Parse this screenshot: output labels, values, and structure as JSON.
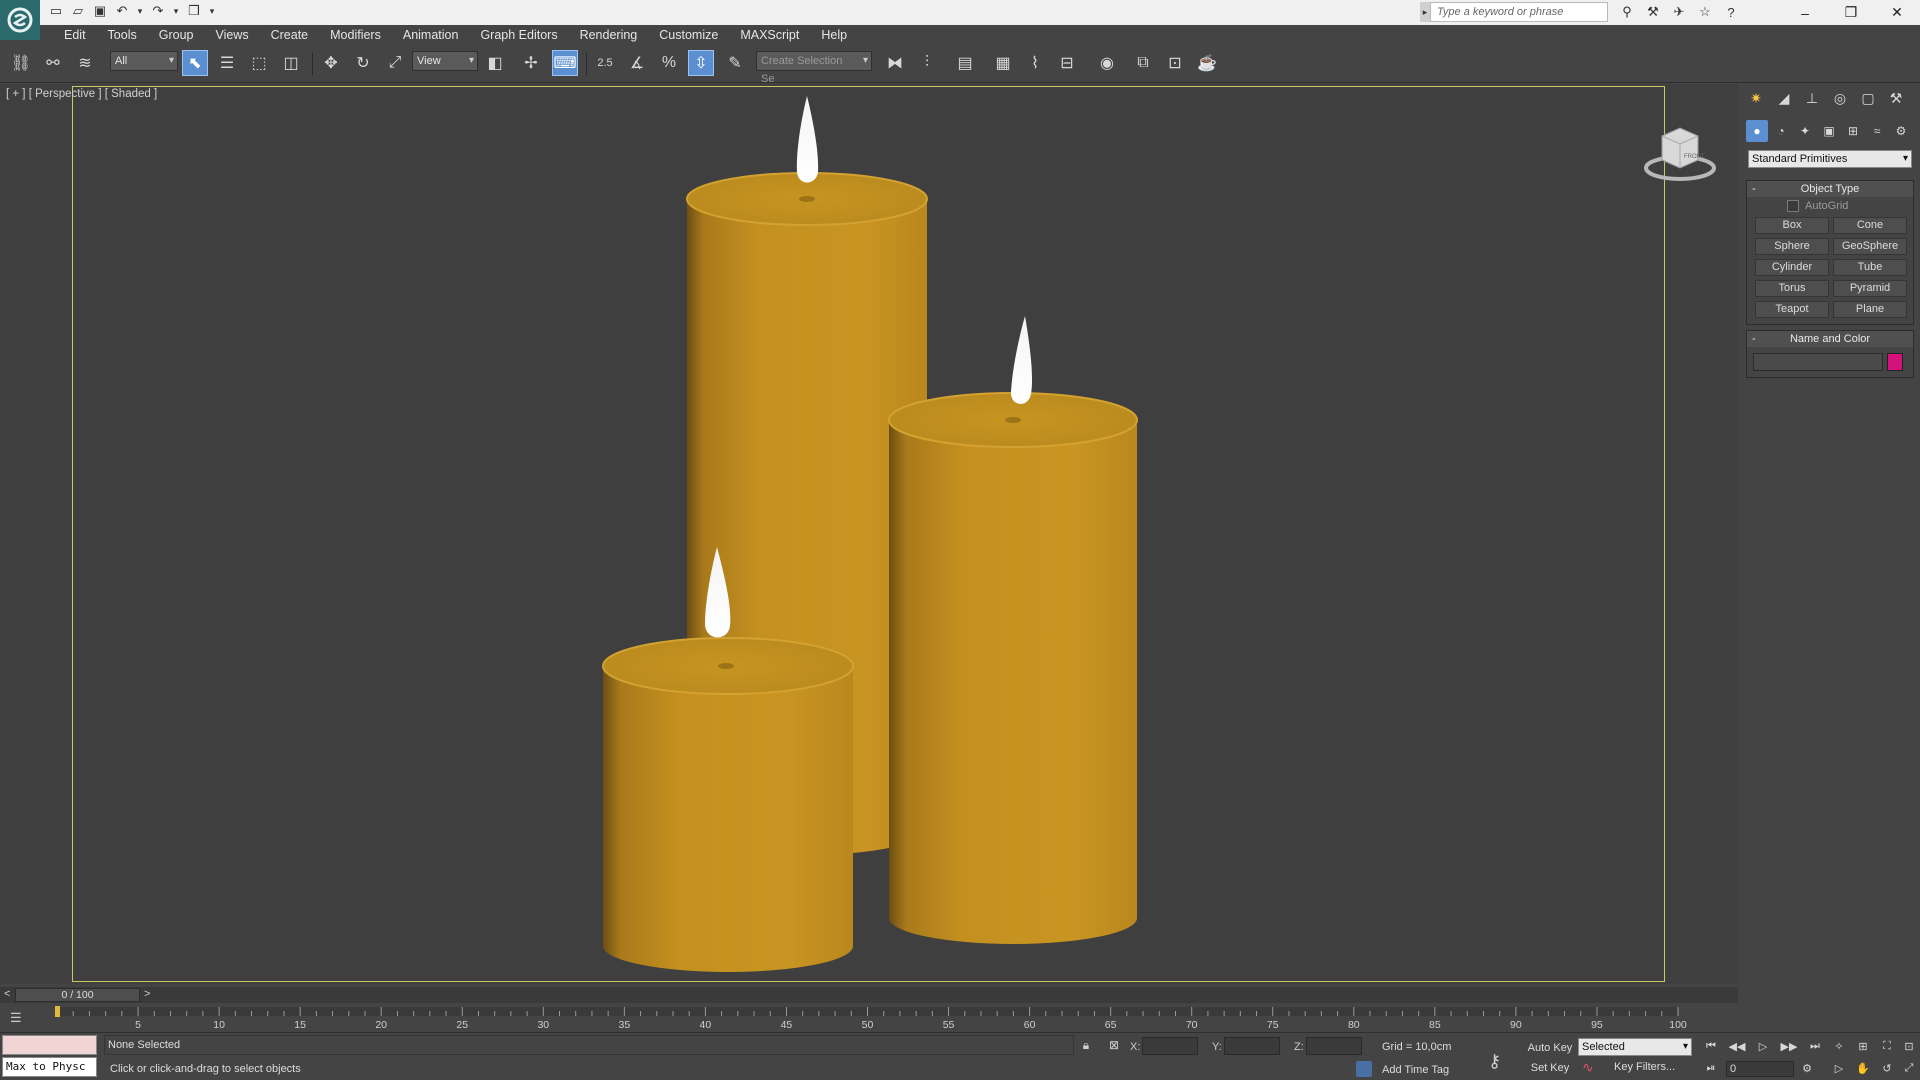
{
  "titlebar": {
    "search_placeholder": "Type a keyword or phrase",
    "window_buttons": [
      "–",
      "❐",
      "✕"
    ]
  },
  "menu": {
    "items": [
      "Edit",
      "Tools",
      "Group",
      "Views",
      "Create",
      "Modifiers",
      "Animation",
      "Graph Editors",
      "Rendering",
      "Customize",
      "MAXScript",
      "Help"
    ]
  },
  "toolbar": {
    "selection_filter": "All",
    "reference_coord": "View",
    "snap_value": "2.5",
    "selection_set_placeholder": "Create Selection Se"
  },
  "viewport": {
    "label": "[ + ] [ Perspective ] [ Shaded ]",
    "viewcube_face": "FRONT"
  },
  "command_panel": {
    "category": "Standard Primitives",
    "object_type_title": "Object Type",
    "autogrid_label": "AutoGrid",
    "object_buttons": [
      "Box",
      "Cone",
      "Sphere",
      "GeoSphere",
      "Cylinder",
      "Tube",
      "Torus",
      "Pyramid",
      "Teapot",
      "Plane"
    ],
    "name_color_title": "Name and Color",
    "object_color": "#d4127c"
  },
  "timeline": {
    "thumb_label": "0 / 100",
    "ticks": [
      5,
      10,
      15,
      20,
      25,
      30,
      35,
      40,
      45,
      50,
      55,
      60,
      65,
      70,
      75,
      80,
      85,
      90,
      95,
      100
    ]
  },
  "status": {
    "maxscript_text": "Max to Physc",
    "selection": "None Selected",
    "prompt": "Click or click-and-drag to select objects",
    "x_label": "X:",
    "y_label": "Y:",
    "z_label": "Z:",
    "grid": "Grid = 10,0cm",
    "add_time_tag": "Add Time Tag",
    "auto_key": "Auto Key",
    "set_key": "Set Key",
    "key_mode": "Selected",
    "key_filters": "Key Filters...",
    "current_frame": "0"
  },
  "scene": {
    "wax_color": "#c4901f",
    "flame_color": "#ffffff"
  }
}
